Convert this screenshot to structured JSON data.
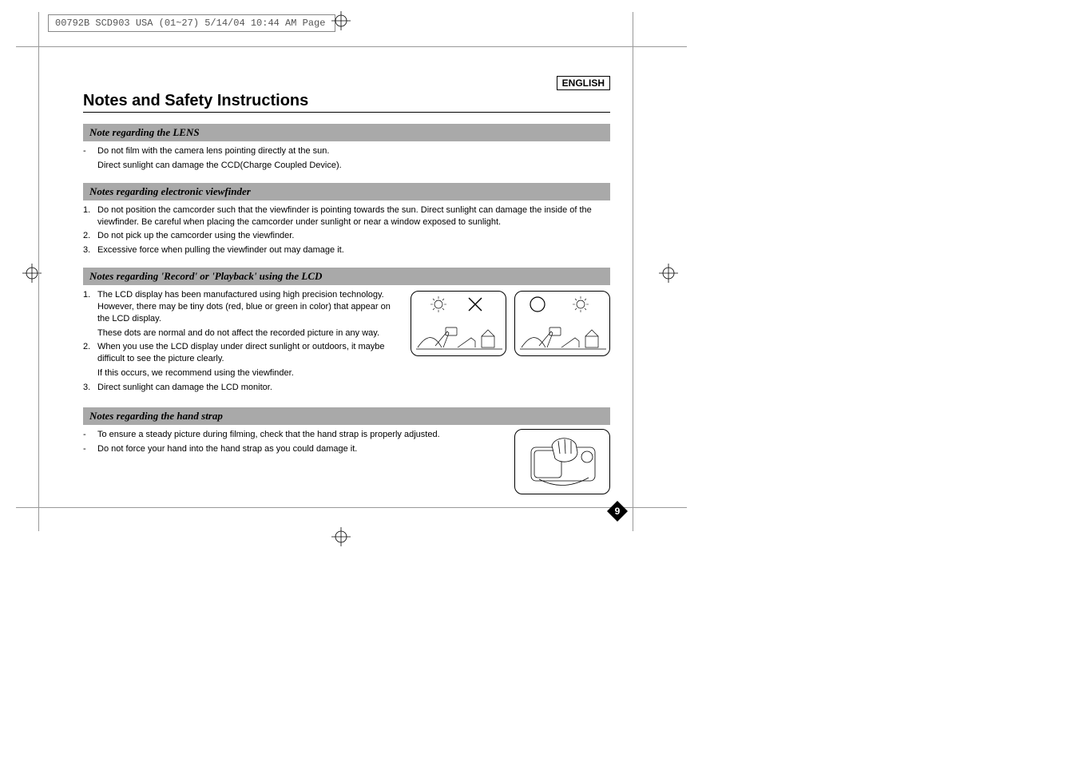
{
  "prepress": {
    "header": "00792B SCD903 USA (01~27)  5/14/04 10:44 AM  Page"
  },
  "language_label": "ENGLISH",
  "page_title": "Notes and Safety Instructions",
  "page_number": "9",
  "sections": {
    "lens": {
      "heading": "Note regarding the LENS",
      "items": [
        {
          "marker": "-",
          "text": "Do not film with the camera lens pointing directly at the sun."
        },
        {
          "marker": "",
          "text": "Direct sunlight can damage the CCD(Charge Coupled Device)."
        }
      ]
    },
    "viewfinder": {
      "heading": "Notes regarding electronic viewfinder",
      "items": [
        {
          "marker": "1.",
          "text": "Do not position the camcorder such that the viewfinder is pointing towards the sun. Direct sunlight can damage the inside of the viewfinder. Be careful when placing the camcorder under sunlight or near a window exposed to sunlight."
        },
        {
          "marker": "2.",
          "text": "Do not pick up the camcorder using the viewfinder."
        },
        {
          "marker": "3.",
          "text": "Excessive force when pulling the viewfinder out may damage it."
        }
      ]
    },
    "lcd": {
      "heading": "Notes regarding 'Record' or 'Playback' using the LCD",
      "items": [
        {
          "marker": "1.",
          "text": "The LCD display has been manufactured using high precision technology. However, there may be tiny dots (red, blue or green in color) that appear on the LCD display."
        },
        {
          "marker": "",
          "text": "These dots are normal and do not affect the recorded picture in any way."
        },
        {
          "marker": "2.",
          "text": "When you use the LCD display under direct sunlight or outdoors, it maybe difficult to see the picture clearly."
        },
        {
          "marker": "",
          "text": "If this occurs, we recommend using the viewfinder."
        },
        {
          "marker": "3.",
          "text": "Direct sunlight can damage the LCD monitor."
        }
      ]
    },
    "handstrap": {
      "heading": "Notes regarding the hand strap",
      "items": [
        {
          "marker": "-",
          "text": "To ensure a steady picture during filming, check that the hand strap is properly adjusted."
        },
        {
          "marker": "-",
          "text": "Do not force your hand into the hand strap as you could damage it."
        }
      ]
    }
  }
}
